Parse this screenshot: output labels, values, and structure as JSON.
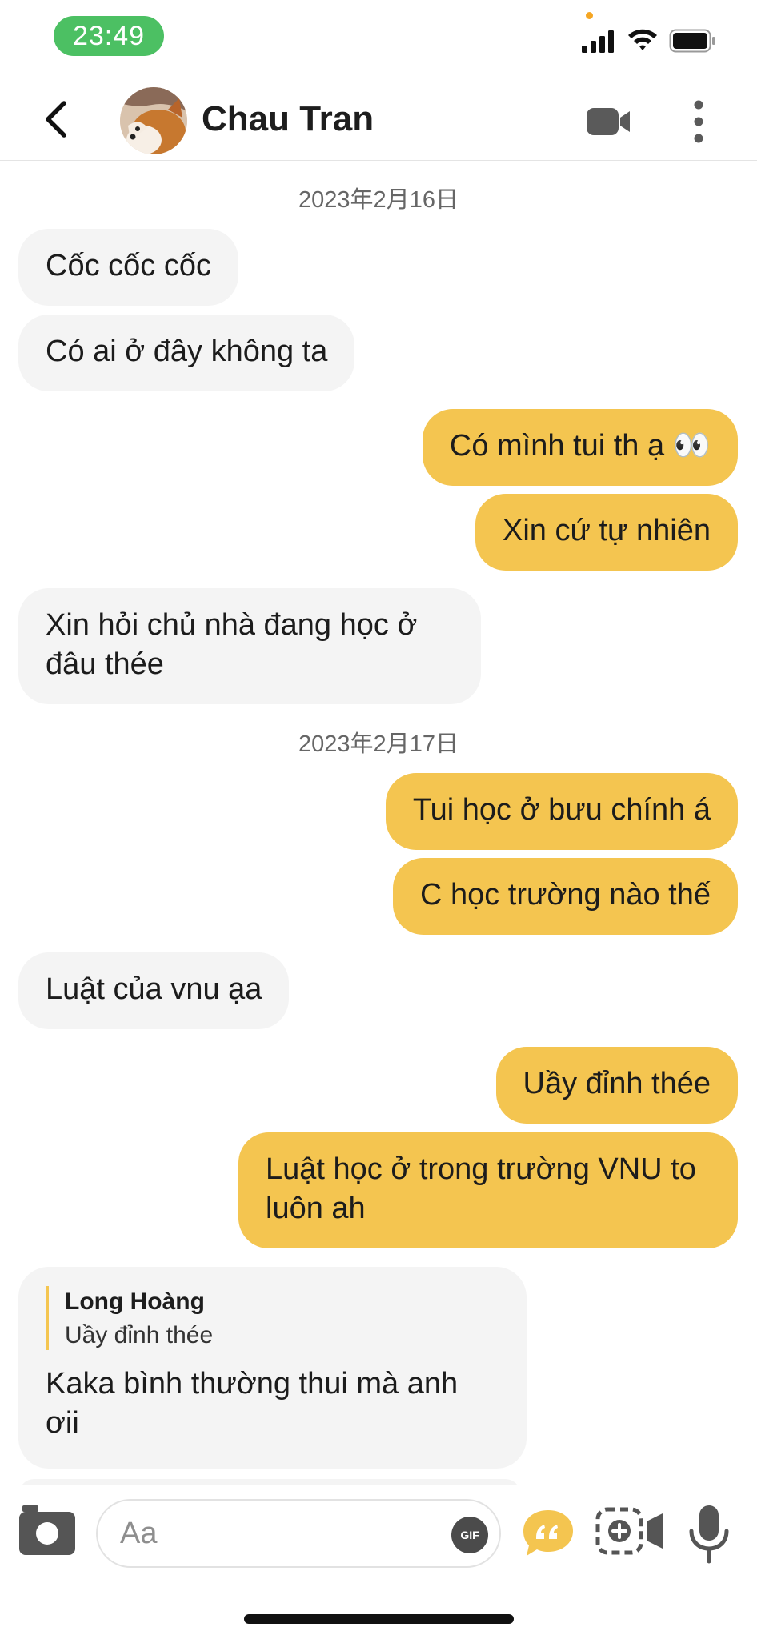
{
  "status_bar": {
    "time": "23:49"
  },
  "header": {
    "back_label": "Back",
    "contact_name": "Chau Tran"
  },
  "chat": {
    "date_1": "2023年2月16日",
    "date_2": "2023年2月17日",
    "messages": [
      {
        "sender": "them",
        "text": "Cốc cốc cốc"
      },
      {
        "sender": "them",
        "text": "Có ai ở đây không ta"
      },
      {
        "sender": "me",
        "text": "Có mình tui th ạ 👀"
      },
      {
        "sender": "me",
        "text": "Xin cứ tự nhiên"
      },
      {
        "sender": "them",
        "text": "Xin hỏi chủ nhà đang học ở đâu thée"
      },
      {
        "sender": "me",
        "text": "Tui học ở bưu chính á"
      },
      {
        "sender": "me",
        "text": "C học trường nào thế"
      },
      {
        "sender": "them",
        "text": "Luật của vnu ạa"
      },
      {
        "sender": "me",
        "text": "Uầy đỉnh thée"
      },
      {
        "sender": "me",
        "text": "Luật học ở trong trường VNU to luôn ah"
      },
      {
        "sender": "them",
        "text": "Kaka bình thường thui mà anh ơii"
      }
    ],
    "reply": {
      "quoted_author": "Long Hoàng",
      "quoted_text": "Uầy đỉnh thée"
    }
  },
  "composer": {
    "placeholder": "Aa",
    "gif_label": "GIF"
  },
  "colors": {
    "accent": "#f4c550",
    "incoming_bubble": "#f4f4f4",
    "time_pill": "#4cc063"
  },
  "icons": [
    "back-chevron-icon",
    "video-call-icon",
    "more-vertical-icon",
    "camera-icon",
    "gif-icon",
    "quote-icon",
    "video-message-icon",
    "microphone-icon"
  ]
}
